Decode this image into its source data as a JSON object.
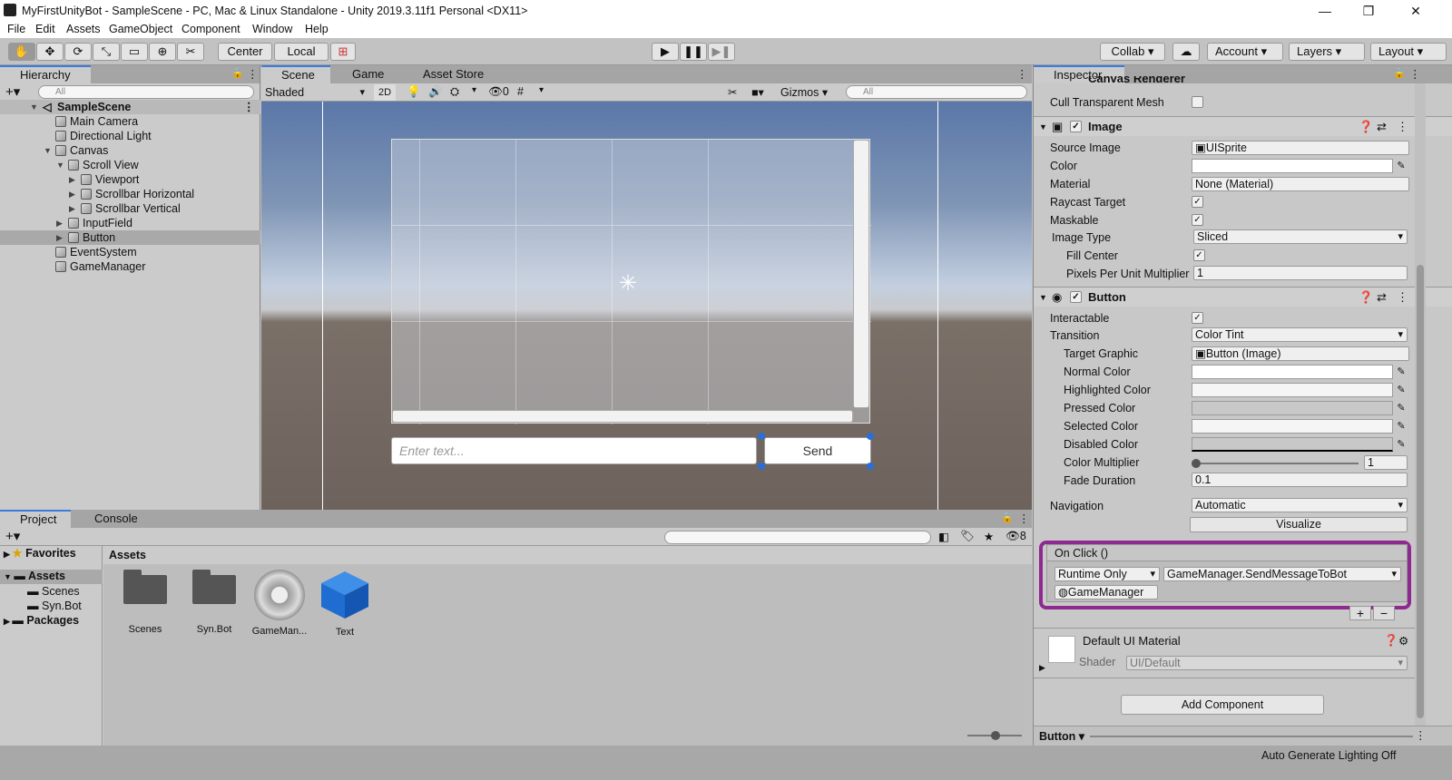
{
  "window": {
    "title": "MyFirstUnityBot - SampleScene - PC, Mac & Linux Standalone - Unity 2019.3.11f1 Personal <DX11>",
    "minimize": "—",
    "maximize": "❐",
    "close": "✕"
  },
  "menu": [
    "File",
    "Edit",
    "Assets",
    "GameObject",
    "Component",
    "Window",
    "Help"
  ],
  "toolbar": {
    "center": "Center",
    "local": "Local",
    "collab": "Collab",
    "account": "Account",
    "layers": "Layers",
    "layout": "Layout"
  },
  "hierarchy": {
    "tab": "Hierarchy",
    "search_placeholder": "All",
    "scene": "SampleScene",
    "items": [
      {
        "label": "Main Camera",
        "depth": 1
      },
      {
        "label": "Directional Light",
        "depth": 1
      },
      {
        "label": "Canvas",
        "depth": 1
      },
      {
        "label": "Scroll View",
        "depth": 2
      },
      {
        "label": "Viewport",
        "depth": 3
      },
      {
        "label": "Scrollbar Horizontal",
        "depth": 3
      },
      {
        "label": "Scrollbar Vertical",
        "depth": 3
      },
      {
        "label": "InputField",
        "depth": 2
      },
      {
        "label": "Button",
        "depth": 2
      },
      {
        "label": "EventSystem",
        "depth": 1
      },
      {
        "label": "GameManager",
        "depth": 1
      }
    ]
  },
  "scene": {
    "tabs": [
      "Scene",
      "Game",
      "Asset Store"
    ],
    "shading": "Shaded",
    "mode_2d": "2D",
    "hidden_count": "0",
    "gizmos": "Gizmos",
    "search_placeholder": "All",
    "input_placeholder": "Enter text...",
    "button_label": "Send"
  },
  "project": {
    "tabs": [
      "Project",
      "Console"
    ],
    "favorites": "Favorites",
    "assets": "Assets",
    "scenes": "Scenes",
    "synbot": "Syn.Bot",
    "packages": "Packages",
    "breadcrumb": "Assets",
    "hidden_count": "8",
    "files": [
      {
        "label": "Scenes",
        "kind": "folder"
      },
      {
        "label": "Syn.Bot",
        "kind": "folder"
      },
      {
        "label": "GameMan...",
        "kind": "gear"
      },
      {
        "label": "Text",
        "kind": "cube"
      }
    ]
  },
  "inspector": {
    "tab": "Inspector",
    "canvas_renderer": "Canvas Renderer",
    "cull_transparent_mesh": "Cull Transparent Mesh",
    "image": {
      "title": "Image",
      "source_image_label": "Source Image",
      "source_image": "UISprite",
      "color_label": "Color",
      "material_label": "Material",
      "material": "None (Material)",
      "raycast_label": "Raycast Target",
      "maskable_label": "Maskable",
      "image_type_label": "Image Type",
      "image_type": "Sliced",
      "fill_center_label": "Fill Center",
      "ppu_label": "Pixels Per Unit Multiplier",
      "ppu": "1"
    },
    "button": {
      "title": "Button",
      "interactable_label": "Interactable",
      "transition_label": "Transition",
      "transition": "Color Tint",
      "target_graphic_label": "Target Graphic",
      "target_graphic": "Button (Image)",
      "normal_color": "Normal Color",
      "highlighted_color": "Highlighted Color",
      "pressed_color": "Pressed Color",
      "selected_color": "Selected Color",
      "disabled_color": "Disabled Color",
      "color_multiplier_label": "Color Multiplier",
      "color_multiplier": "1",
      "fade_duration_label": "Fade Duration",
      "fade_duration": "0.1",
      "navigation_label": "Navigation",
      "navigation": "Automatic",
      "visualize": "Visualize"
    },
    "on_click": {
      "title": "On Click ()",
      "runtime": "Runtime Only",
      "function": "GameManager.SendMessageToBot",
      "object": "GameManager",
      "add": "+",
      "remove": "−"
    },
    "material": {
      "name": "Default UI Material",
      "shader_label": "Shader",
      "shader": "UI/Default"
    },
    "add_component": "Add Component",
    "footer": "Button"
  },
  "status": {
    "text": "Auto Generate Lighting Off"
  },
  "colors": {
    "highlight_border": "#8e2a8f",
    "tab_accent": "#3c7be0",
    "handle": "#2b6fd6"
  }
}
